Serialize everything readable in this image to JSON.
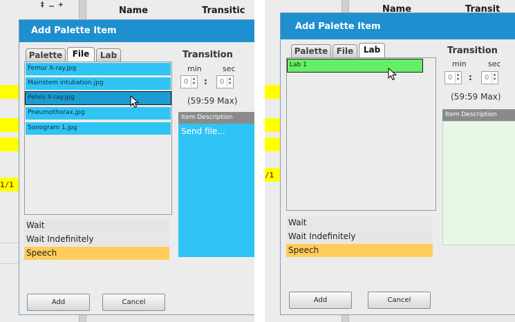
{
  "background": {
    "column_name_header": "Name",
    "column_transition_header": "Transitic",
    "right_column_transition_header": "Transit",
    "row_marker_left": "1/1",
    "row_marker_right": "/1",
    "top_marker": "‡ … +"
  },
  "left_dialog": {
    "title": "Add Palette Item",
    "tabs": [
      "Palette",
      "File",
      "Lab"
    ],
    "active_tab": "File",
    "files": [
      "Femur X-ray.jpg",
      "Mainstem intubation.jpg",
      "Pelvis X-ray.jpg",
      "Pneumothorax.jpg",
      "Sonogram 1.jpg"
    ],
    "selected_file": "Pelvis X-ray.jpg",
    "transition": {
      "title": "Transition",
      "min_label": "min",
      "sec_label": "sec",
      "min_value": "0",
      "sec_value": "0",
      "separator": ":",
      "max_note": "(59:59 Max)"
    },
    "item_description": {
      "header": "Item Description",
      "text": "Send file..."
    },
    "options": [
      "Wait",
      "Wait Indefinitely",
      "Speech"
    ],
    "highlighted_option": "Speech",
    "buttons": {
      "add": "Add",
      "cancel": "Cancel"
    }
  },
  "right_dialog": {
    "title": "Add Palette Item",
    "tabs": [
      "Palette",
      "File",
      "Lab"
    ],
    "active_tab": "Lab",
    "labs": [
      "Lab 1"
    ],
    "transition": {
      "title": "Transition",
      "min_label": "min",
      "sec_label": "sec",
      "min_value": "0",
      "sec_value": "0",
      "separator": ":",
      "max_note": "(59:59 Max)"
    },
    "item_description": {
      "header": "Item Description",
      "text": ""
    },
    "options": [
      "Wait",
      "Wait Indefinitely",
      "Speech"
    ],
    "highlighted_option": "Speech",
    "buttons": {
      "add": "Add",
      "cancel": "Cancel"
    }
  },
  "colors": {
    "title_bar": "#1e8fcf",
    "file_item": "#30c4f4",
    "file_item_selected": "#1d9bd3",
    "lab_item": "#66ee66",
    "speech_highlight": "#ffcc5a",
    "description_file": "#30c4f4",
    "description_lab": "#e6f9e6",
    "row_highlight": "#ffff00"
  }
}
